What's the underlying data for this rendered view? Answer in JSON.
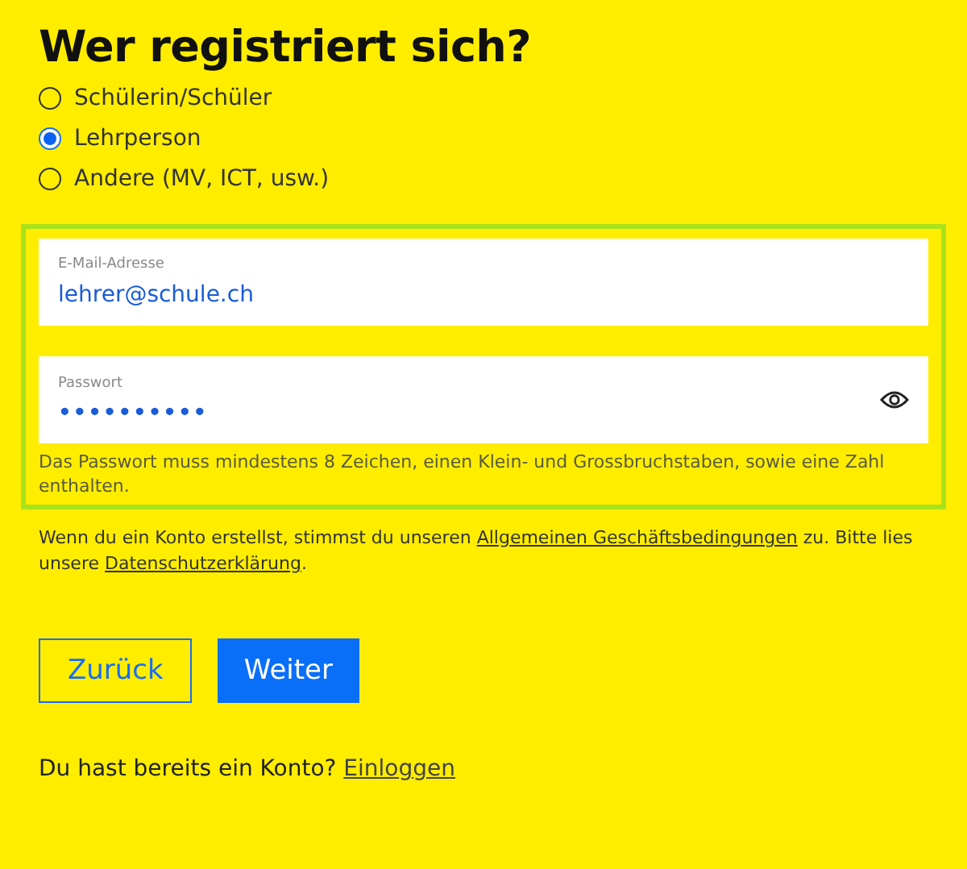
{
  "heading": "Wer registriert sich?",
  "roles": [
    {
      "label": "Schülerin/Schüler",
      "selected": false
    },
    {
      "label": "Lehrperson",
      "selected": true
    },
    {
      "label": "Andere (MV, ICT, usw.)",
      "selected": false
    }
  ],
  "email_field": {
    "label": "E-Mail-Adresse",
    "value": "lehrer@schule.ch"
  },
  "password_field": {
    "label": "Passwort",
    "value": "••••••••••"
  },
  "password_hint": "Das Passwort muss mindestens 8 Zeichen, einen Klein- und Grossbruchstaben, sowie eine Zahl enthalten.",
  "terms": {
    "text_1": "Wenn du ein Konto erstellst, stimmst du unseren",
    "link_1": "Allgemeinen Geschäftsbedingungen",
    "text_2": "zu. Bitte lies unsere",
    "link_2": "Datenschutzerklärung",
    "text_3": "."
  },
  "buttons": [
    {
      "label": "Zurück",
      "kind": "secondary"
    },
    {
      "label": "Weiter",
      "kind": "primary"
    }
  ],
  "login": {
    "text": "Du hast bereits ein Konto?",
    "link": "Einloggen"
  }
}
